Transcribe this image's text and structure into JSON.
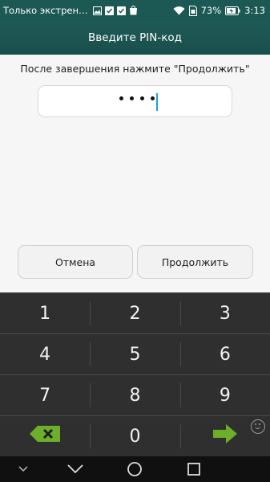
{
  "status_bar": {
    "carrier": "Только экстрен…",
    "battery_percent": "73%",
    "time": "3:13",
    "icons": [
      "image-icon",
      "checklist-icon",
      "checklist-icon",
      "shopping-bag-icon",
      "wifi-icon",
      "sim-icon",
      "battery-icon"
    ]
  },
  "header": {
    "title": "Введите PIN-код"
  },
  "main": {
    "instruction": "После завершения нажмите \"Продолжить\"",
    "pin_field": {
      "masked_value": "••••",
      "digits_entered": 4
    },
    "cancel_label": "Отмена",
    "continue_label": "Продолжить"
  },
  "keypad": {
    "rows": [
      [
        "1",
        "2",
        "3"
      ],
      [
        "4",
        "5",
        "6"
      ],
      [
        "7",
        "8",
        "9"
      ],
      [
        "",
        "0",
        ""
      ]
    ],
    "special_keys": [
      "backspace-key",
      "enter-key",
      "emoji-icon"
    ],
    "colors": {
      "background": "#2f2f2f",
      "accent_green": "#6dae2a",
      "divider": "#4a4a4a"
    }
  },
  "nav_bar": {
    "icons": [
      "hide-keyboard-icon",
      "back-icon",
      "home-icon",
      "recents-icon"
    ]
  },
  "colors": {
    "header": "#1d5954",
    "cursor": "#1aa6c9",
    "content_bg": "#f6f6f6"
  }
}
